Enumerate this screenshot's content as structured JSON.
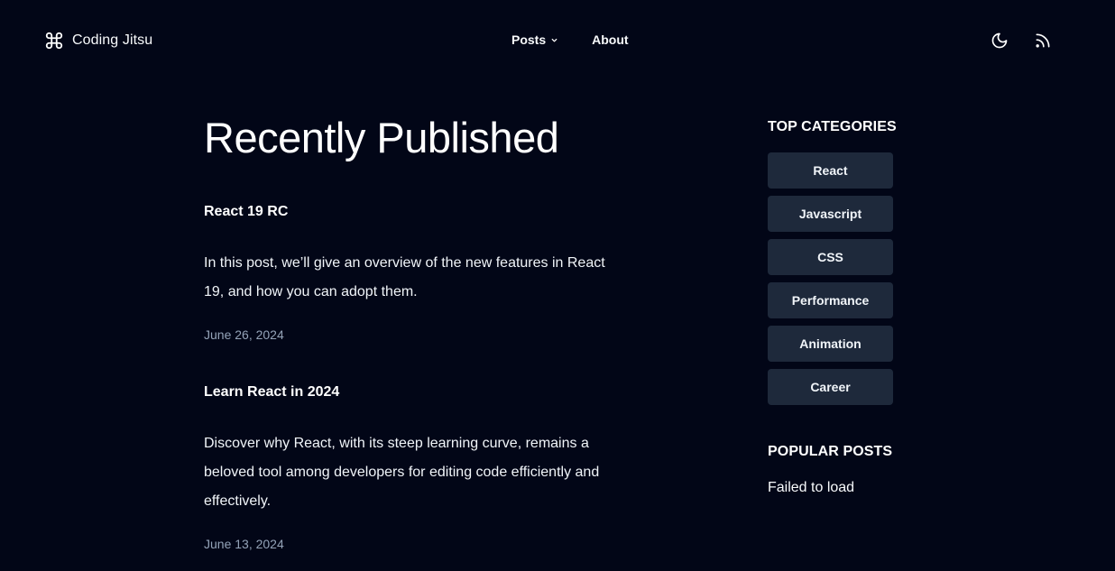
{
  "header": {
    "brand": {
      "name": "Coding Jitsu",
      "icon": "command-icon"
    },
    "nav": [
      {
        "label": "Posts",
        "has_dropdown": true
      },
      {
        "label": "About",
        "has_dropdown": false
      }
    ],
    "actions": {
      "theme_icon": "moon-icon",
      "feed_icon": "rss-icon"
    }
  },
  "main": {
    "title": "Recently Published",
    "posts": [
      {
        "title": "React 19 RC",
        "excerpt": "In this post, we’ll give an overview of the new features in React 19, and how you can adopt them.",
        "date": "June 26, 2024"
      },
      {
        "title": "Learn React in 2024",
        "excerpt": "Discover why React, with its steep learning curve, remains a beloved tool among developers for editing code efficiently and effectively.",
        "date": "June 13, 2024"
      }
    ]
  },
  "sidebar": {
    "categories_heading": "TOP CATEGORIES",
    "categories": [
      "React",
      "Javascript",
      "CSS",
      "Performance",
      "Animation",
      "Career"
    ],
    "popular_heading": "POPULAR POSTS",
    "popular_message": "Failed to load"
  },
  "colors": {
    "background": "#020617",
    "text": "#ffffff",
    "muted": "#94a3b8",
    "category_bg": "#1e293b"
  }
}
